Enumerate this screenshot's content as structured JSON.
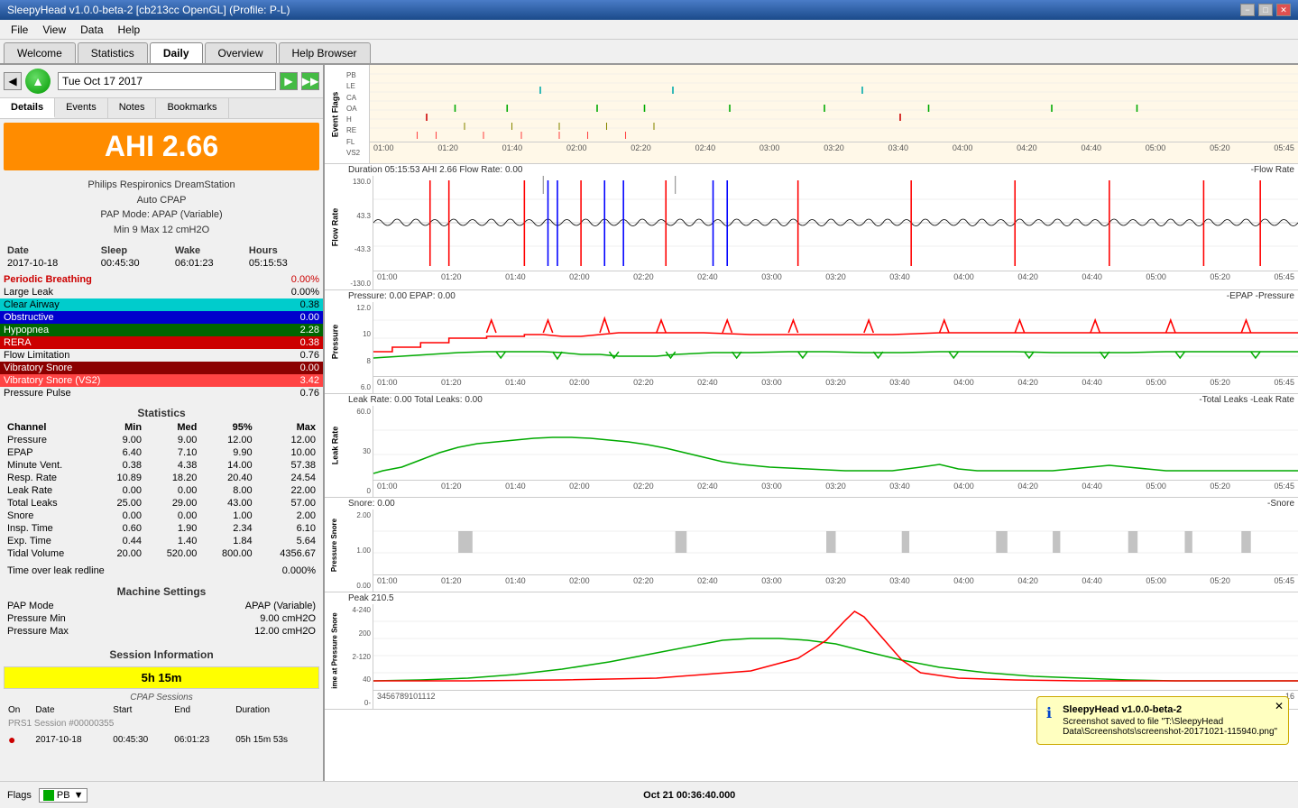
{
  "titlebar": {
    "title": "SleepyHead v1.0.0-beta-2 [cb213cc OpenGL] (Profile: P-L)",
    "min_label": "−",
    "max_label": "□",
    "close_label": "✕"
  },
  "menubar": {
    "items": [
      "File",
      "View",
      "Data",
      "Help"
    ]
  },
  "tabs": {
    "items": [
      "Welcome",
      "Statistics",
      "Daily",
      "Overview",
      "Help Browser"
    ],
    "active": "Daily"
  },
  "nav": {
    "back_label": "◀",
    "forward_label": "▶",
    "jump_label": "▶▶",
    "date": "Tue Oct 17 2017"
  },
  "left_tabs": {
    "items": [
      "Details",
      "Events",
      "Notes",
      "Bookmarks"
    ],
    "active": "Details"
  },
  "ahi": {
    "value": "AHI 2.66"
  },
  "device": {
    "name": "Philips Respironics DreamStation",
    "mode_line": "Auto CPAP",
    "pap_mode": "PAP Mode: APAP (Variable)",
    "pressure": "Min 9 Max 12 cmH2O"
  },
  "date_stats": {
    "headers": [
      "Date",
      "Sleep",
      "Wake",
      "Hours"
    ],
    "row": [
      "2017-10-18",
      "00:45:30",
      "06:01:23",
      "05:15:53"
    ]
  },
  "events": [
    {
      "label": "Periodic Breathing",
      "value": "0.00%",
      "style": "normal"
    },
    {
      "label": "Large Leak",
      "value": "0.00%",
      "style": "normal"
    },
    {
      "label": "Clear Airway",
      "value": "0.38",
      "style": "cyan"
    },
    {
      "label": "Obstructive",
      "value": "0.00",
      "style": "blue"
    },
    {
      "label": "Hypopnea",
      "value": "2.28",
      "style": "green"
    },
    {
      "label": "RERA",
      "value": "0.38",
      "style": "red"
    },
    {
      "label": "Flow Limitation",
      "value": "0.76",
      "style": "normal"
    },
    {
      "label": "Vibratory Snore",
      "value": "0.00",
      "style": "dark-red"
    },
    {
      "label": "Vibratory Snore (VS2)",
      "value": "3.42",
      "style": "red2"
    },
    {
      "label": "Pressure Pulse",
      "value": "0.76",
      "style": "normal"
    }
  ],
  "stats_header": "Statistics",
  "channel_stats": {
    "headers": [
      "Channel",
      "Min",
      "Med",
      "95%",
      "Max"
    ],
    "rows": [
      [
        "Pressure",
        "9.00",
        "9.00",
        "12.00",
        "12.00"
      ],
      [
        "EPAP",
        "6.40",
        "7.10",
        "9.90",
        "10.00"
      ],
      [
        "Minute Vent.",
        "0.38",
        "4.38",
        "14.00",
        "57.38"
      ],
      [
        "Resp. Rate",
        "10.89",
        "18.20",
        "20.40",
        "24.54"
      ],
      [
        "Leak Rate",
        "0.00",
        "0.00",
        "8.00",
        "22.00"
      ],
      [
        "Total Leaks",
        "25.00",
        "29.00",
        "43.00",
        "57.00"
      ],
      [
        "Snore",
        "0.00",
        "0.00",
        "1.00",
        "2.00"
      ],
      [
        "Insp. Time",
        "0.60",
        "1.90",
        "2.34",
        "6.10"
      ],
      [
        "Exp. Time",
        "0.44",
        "1.40",
        "1.84",
        "5.64"
      ],
      [
        "Tidal Volume",
        "20.00",
        "520.00",
        "800.00",
        "4356.67"
      ]
    ]
  },
  "leak_redline": {
    "label": "Time over leak redline",
    "value": "0.000%"
  },
  "machine_settings": {
    "header": "Machine Settings",
    "rows": [
      {
        "label": "PAP Mode",
        "value": "APAP (Variable)"
      },
      {
        "label": "Pressure Min",
        "value": "9.00 cmH2O"
      },
      {
        "label": "Pressure Max",
        "value": "12.00 cmH2O"
      }
    ]
  },
  "session_info": {
    "header": "Session Information",
    "duration": "5h 15m",
    "cpap_label": "CPAP Sessions",
    "table_headers": [
      "On",
      "Date",
      "Start",
      "End",
      "Duration"
    ],
    "session_row": {
      "on": "●",
      "date": "2017-10-18",
      "start": "00:45:30",
      "end": "06:01:23",
      "duration": "05h 15m 53s",
      "session_num": "PRS1 Session #00000355"
    }
  },
  "charts": {
    "flags": {
      "title": "Event Flags",
      "labels": [
        "PB",
        "LE",
        "CA",
        "OA",
        "H",
        "RE",
        "FL",
        "VS2"
      ],
      "time_labels": [
        "01:00",
        "01:20",
        "01:40",
        "02:00",
        "02:20",
        "02:40",
        "03:00",
        "03:20",
        "03:40",
        "04:00",
        "04:20",
        "04:40",
        "05:00",
        "05:20",
        "05:45"
      ]
    },
    "flow_rate": {
      "title": "Duration 05:15:53 AHI 2.66 Flow Rate: 0.00",
      "right_label": "-Flow Rate",
      "y_labels": [
        "130.0",
        "43.3",
        "-43.3",
        "-130.0"
      ],
      "time_labels": [
        "01:00",
        "01:20",
        "01:40",
        "02:00",
        "02:20",
        "02:40",
        "03:00",
        "03:20",
        "03:40",
        "04:00",
        "04:20",
        "04:40",
        "05:00",
        "05:20",
        "05:45"
      ]
    },
    "pressure": {
      "title": "Pressure: 0.00 EPAP: 0.00",
      "right_label": "-EPAP -Pressure",
      "y_labels": [
        "12.0",
        "10",
        "8",
        "6.0"
      ],
      "time_labels": [
        "01:00",
        "01:20",
        "01:40",
        "02:00",
        "02:20",
        "02:40",
        "03:00",
        "03:20",
        "03:40",
        "04:00",
        "04:20",
        "04:40",
        "05:00",
        "05:20",
        "05:45"
      ]
    },
    "leak_rate": {
      "title": "Leak Rate: 0.00 Total Leaks: 0.00",
      "right_label": "-Total Leaks -Leak Rate",
      "y_labels": [
        "60.0",
        "30",
        "0"
      ],
      "time_labels": [
        "01:00",
        "01:20",
        "01:40",
        "02:00",
        "02:20",
        "02:40",
        "03:00",
        "03:20",
        "03:40",
        "04:00",
        "04:20",
        "04:40",
        "05:00",
        "05:20",
        "05:45"
      ]
    },
    "snore": {
      "title": "Snore: 0.00",
      "right_label": "-Snore",
      "y_labels": [
        "2.00",
        "1.00",
        "0.00"
      ],
      "time_labels": [
        "01:00",
        "01:20",
        "01:40",
        "02:00",
        "02:20",
        "02:40",
        "03:00",
        "03:20",
        "03:40",
        "04:00",
        "04:20",
        "04:40",
        "05:00",
        "05:20",
        "05:45"
      ]
    },
    "tidal": {
      "title": "Peak 210.5",
      "y_labels": [
        "4-240",
        "200",
        "2-120",
        "40",
        "0-"
      ],
      "time_labels": [
        "3",
        "4",
        "5",
        "6",
        "7",
        "8",
        "9",
        "10",
        "11",
        "12",
        "16"
      ]
    }
  },
  "statusbar": {
    "flags_label": "Flags",
    "pb_label": "PB",
    "timestamp": "Oct 21 00:36:40.000"
  },
  "notification": {
    "app": "SleepyHead v1.0.0-beta-2",
    "message": "Screenshot saved to file \"T:\\SleepyHead Data\\Screenshots\\screenshot-20171021-115940.png\""
  }
}
